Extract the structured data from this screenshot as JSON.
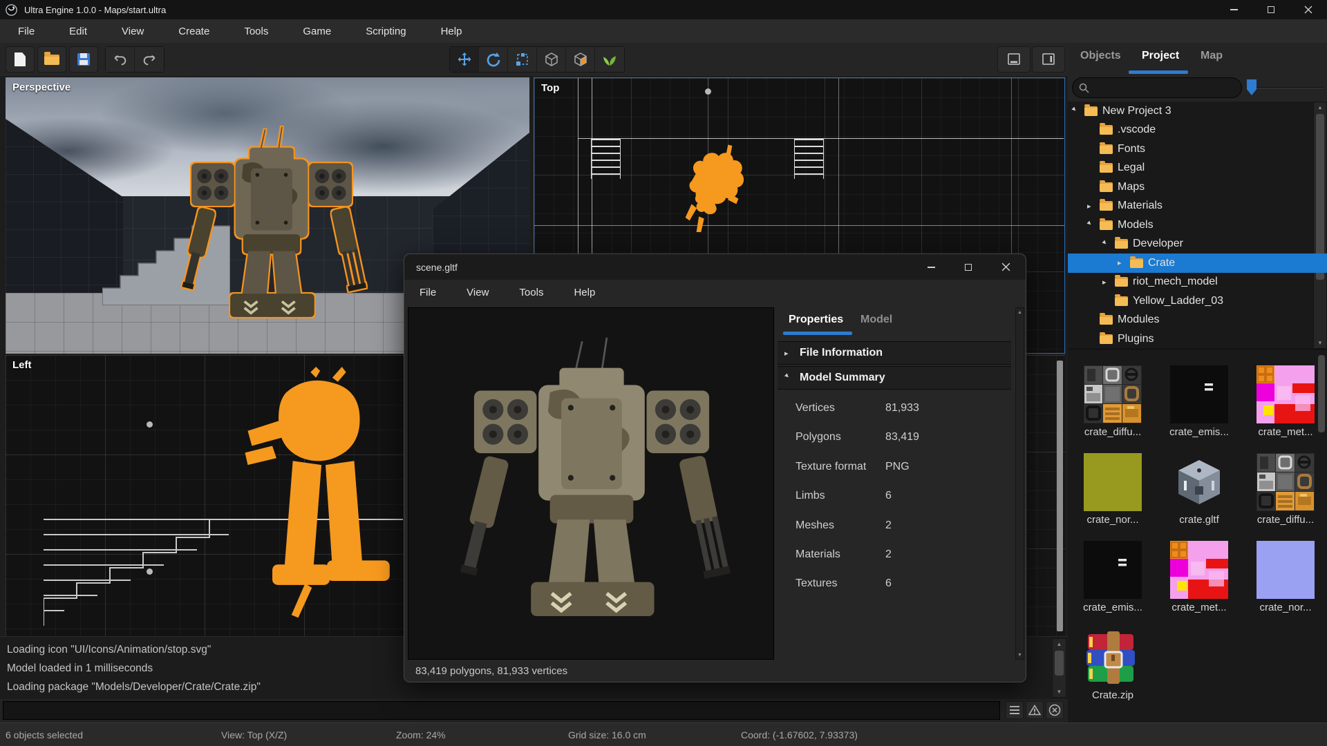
{
  "app": {
    "title": "Ultra Engine 1.0.0 - Maps/start.ultra",
    "menu": [
      "File",
      "Edit",
      "View",
      "Create",
      "Tools",
      "Game",
      "Scripting",
      "Help"
    ]
  },
  "viewports": {
    "perspective": "Perspective",
    "top": "Top",
    "left": "Left"
  },
  "right_panel": {
    "tabs": [
      {
        "label": "Objects",
        "active": false
      },
      {
        "label": "Project",
        "active": true
      },
      {
        "label": "Map",
        "active": false
      }
    ],
    "search": {
      "placeholder": ""
    },
    "tree": [
      {
        "label": "New Project 3",
        "depth": 0,
        "state": "expanded",
        "selected": false
      },
      {
        "label": ".vscode",
        "depth": 1,
        "state": "leaf",
        "selected": false
      },
      {
        "label": "Fonts",
        "depth": 1,
        "state": "leaf",
        "selected": false
      },
      {
        "label": "Legal",
        "depth": 1,
        "state": "leaf",
        "selected": false
      },
      {
        "label": "Maps",
        "depth": 1,
        "state": "leaf",
        "selected": false
      },
      {
        "label": "Materials",
        "depth": 1,
        "state": "collapsed",
        "selected": false
      },
      {
        "label": "Models",
        "depth": 1,
        "state": "expanded",
        "selected": false
      },
      {
        "label": "Developer",
        "depth": 2,
        "state": "expanded",
        "selected": false
      },
      {
        "label": "Crate",
        "depth": 3,
        "state": "collapsed",
        "selected": true
      },
      {
        "label": "riot_mech_model",
        "depth": 2,
        "state": "collapsed",
        "selected": false
      },
      {
        "label": "Yellow_Ladder_03",
        "depth": 2,
        "state": "leaf",
        "selected": false
      },
      {
        "label": "Modules",
        "depth": 1,
        "state": "leaf",
        "selected": false
      },
      {
        "label": "Plugins",
        "depth": 1,
        "state": "leaf",
        "selected": false
      }
    ],
    "assets": [
      {
        "label": "crate_diffu...",
        "kind": "crate-texture"
      },
      {
        "label": "crate_emis...",
        "kind": "black-texture"
      },
      {
        "label": "crate_met...",
        "kind": "pink-texture"
      },
      {
        "label": "crate_nor...",
        "kind": "olive-texture"
      },
      {
        "label": "crate.gltf",
        "kind": "cube-model"
      },
      {
        "label": "crate_diffu...",
        "kind": "crate-texture"
      },
      {
        "label": "crate_emis...",
        "kind": "black-texture"
      },
      {
        "label": "crate_met...",
        "kind": "pink-texture"
      },
      {
        "label": "crate_nor...",
        "kind": "periwinkle-texture"
      },
      {
        "label": "Crate.zip",
        "kind": "zip-archive"
      }
    ]
  },
  "model_window": {
    "title": "scene.gltf",
    "menu": [
      "File",
      "View",
      "Tools",
      "Help"
    ],
    "tabs": [
      {
        "label": "Properties",
        "active": true
      },
      {
        "label": "Model",
        "active": false
      }
    ],
    "sections": [
      {
        "label": "File Information",
        "expanded": false
      },
      {
        "label": "Model Summary",
        "expanded": true
      }
    ],
    "properties": [
      {
        "label": "Vertices",
        "value": "81,933"
      },
      {
        "label": "Polygons",
        "value": "83,419"
      },
      {
        "label": "Texture format",
        "value": "PNG"
      },
      {
        "label": "Limbs",
        "value": "6"
      },
      {
        "label": "Meshes",
        "value": "2"
      },
      {
        "label": "Materials",
        "value": "2"
      },
      {
        "label": "Textures",
        "value": "6"
      }
    ],
    "status": "83,419 polygons, 81,933 vertices"
  },
  "console": {
    "lines": [
      "Loading icon \"UI/Icons/Animation/stop.svg\"",
      "Model loaded in 1 milliseconds",
      "Loading package \"Models/Developer/Crate/Crate.zip\""
    ]
  },
  "status_bar": {
    "selection": "6 objects selected",
    "view": "View: Top (X/Z)",
    "zoom": "Zoom: 24%",
    "grid": "Grid size: 16.0 cm",
    "coord": "Coord: (-1.67602, 7.93373)"
  },
  "icons": {
    "tree_collapsed": "▸",
    "tree_expanded": "▸"
  },
  "colors": {
    "accent": "#2e7bd0",
    "selection": "#1b7ad1",
    "orange_highlight": "#f6941d",
    "folder": "#e9a33b"
  }
}
